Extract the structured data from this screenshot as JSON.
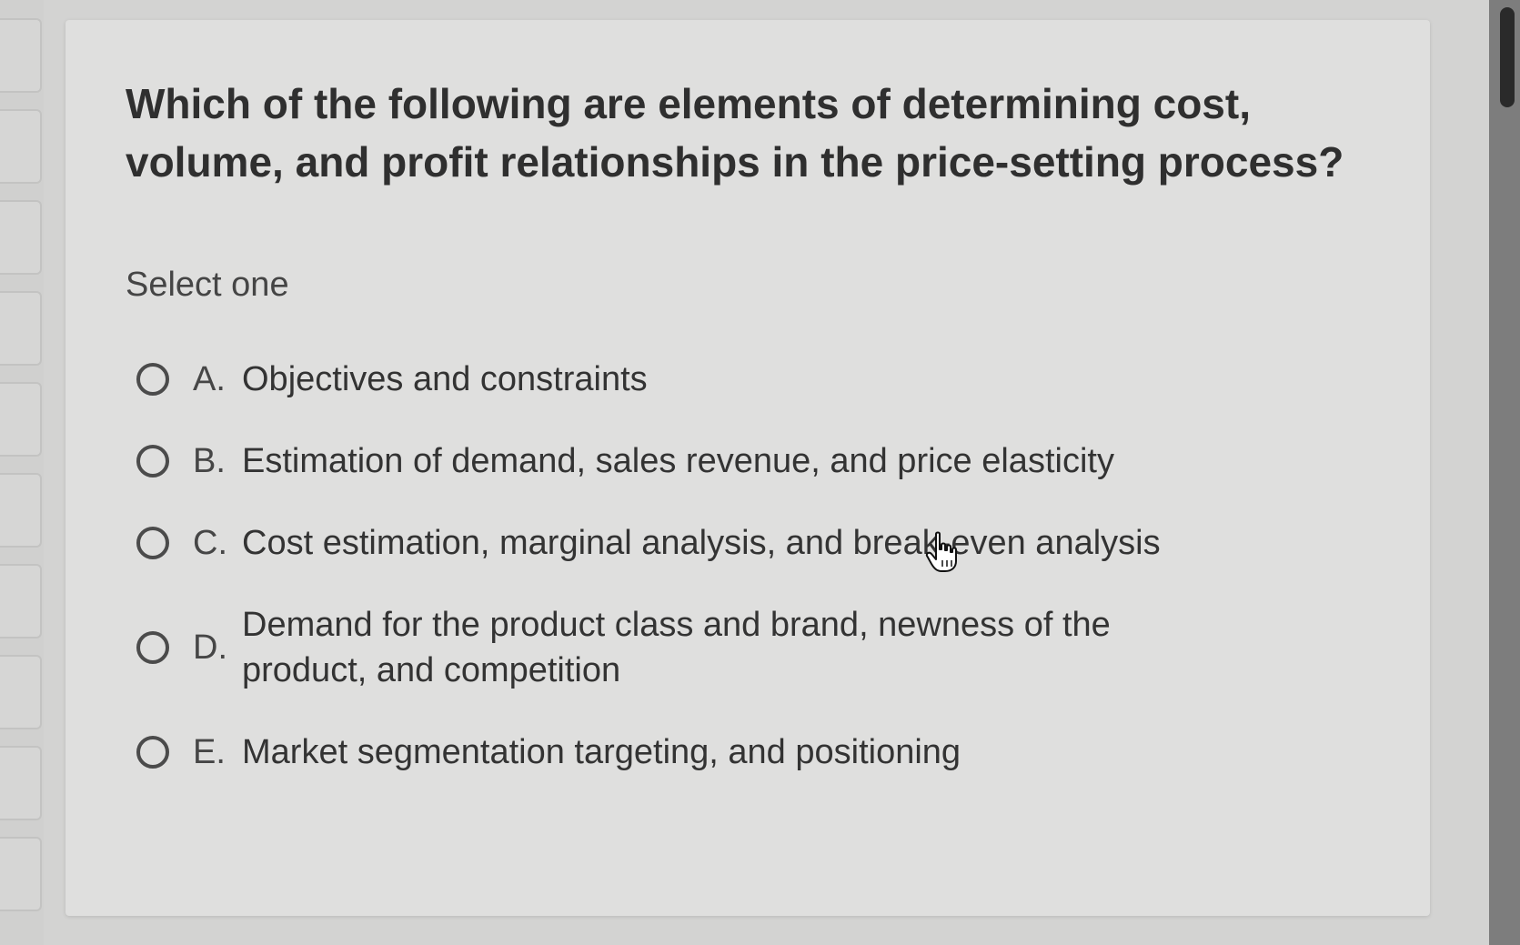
{
  "question": {
    "text": "Which of the following are elements of determining cost, volume, and profit relationships in the price-setting process?",
    "instruction": "Select one"
  },
  "options": [
    {
      "letter": "A.",
      "text": "Objectives and constraints"
    },
    {
      "letter": "B.",
      "text": "Estimation of demand, sales revenue, and price elasticity"
    },
    {
      "letter": "C.",
      "text": "Cost estimation, marginal analysis, and break-even analysis"
    },
    {
      "letter": "D.",
      "text": "Demand for the product class and brand, newness of the product, and competition"
    },
    {
      "letter": "E.",
      "text": "Market segmentation targeting, and positioning"
    }
  ],
  "selected_option": null,
  "icons": {
    "cursor": "hand-pointer-icon",
    "radio": "radio-unchecked-icon"
  },
  "colors": {
    "background": "#d3d3d2",
    "card": "#dfdfde",
    "text": "#2f2f2f",
    "scrollbar": "#7d7d7d"
  }
}
